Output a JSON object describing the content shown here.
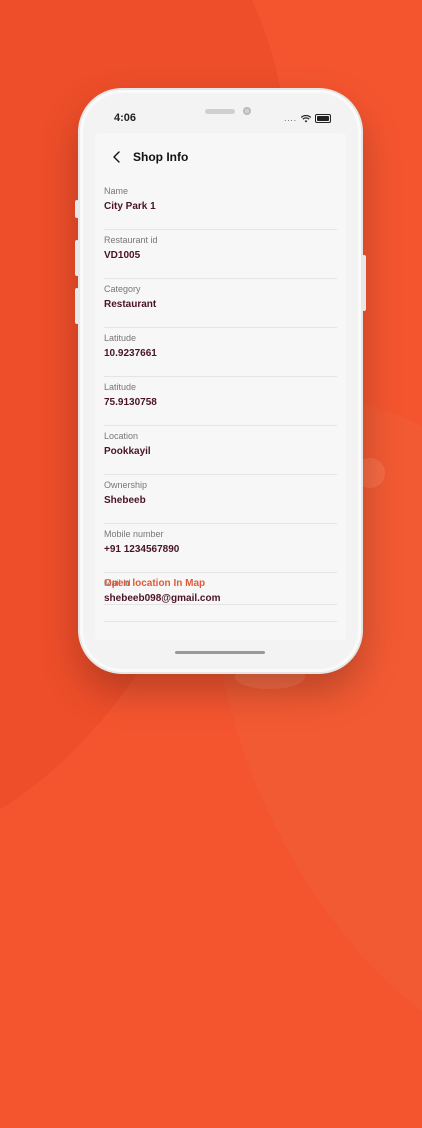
{
  "status_bar": {
    "time": "4:06",
    "dots": "...."
  },
  "header": {
    "title": "Shop Info"
  },
  "fields": [
    {
      "label": "Name",
      "value": "City Park 1"
    },
    {
      "label": "Restaurant id",
      "value": "VD1005"
    },
    {
      "label": "Category",
      "value": "Restaurant"
    },
    {
      "label": "Latitude",
      "value": "10.9237661"
    },
    {
      "label": "Latitude",
      "value": "75.9130758"
    },
    {
      "label": "Location",
      "value": "Pookkayil"
    },
    {
      "label": "Ownership",
      "value": "Shebeeb"
    },
    {
      "label": "Mobile number",
      "value": "+91 1234567890"
    },
    {
      "label": "Mail Id",
      "value": "shebeeb098@gmail.com"
    }
  ],
  "map_link": {
    "label": "Open location In Map"
  },
  "colors": {
    "background": "#f4552f",
    "value_text": "#4a1424",
    "link": "#e25a3a"
  },
  "icons": {
    "back": "back-arrow-icon",
    "wifi": "wifi-icon",
    "battery": "battery-icon"
  }
}
